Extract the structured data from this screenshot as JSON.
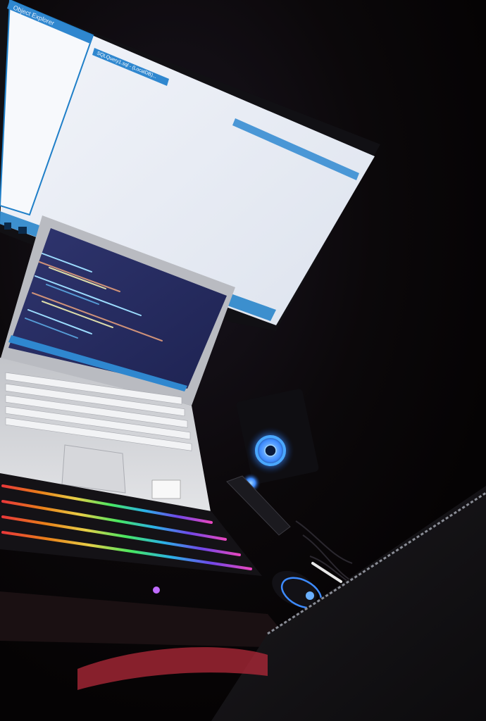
{
  "scene": {
    "description_free": true,
    "monitor": {
      "panel_title": "Object Explorer",
      "tab_label": "SQLQuery1.sql - (LocalDB)...",
      "accent_color": "#1f7fc8",
      "screen_color": "#eef2f8"
    },
    "laptop": {
      "screen_accent_color": "#2a2f6e",
      "body_color": "#cfd0d4"
    },
    "keyboard": {
      "rgb_colors": [
        "#ff3d3d",
        "#ff8c1a",
        "#ffe44d",
        "#4dff6a",
        "#2ec4ff",
        "#7a4dff",
        "#ff4dd2"
      ]
    },
    "speaker_ring_color": "#4aa8ff",
    "mouse_glow_color": "#3d8bff",
    "chair_accent_color": "#b32a3a"
  }
}
